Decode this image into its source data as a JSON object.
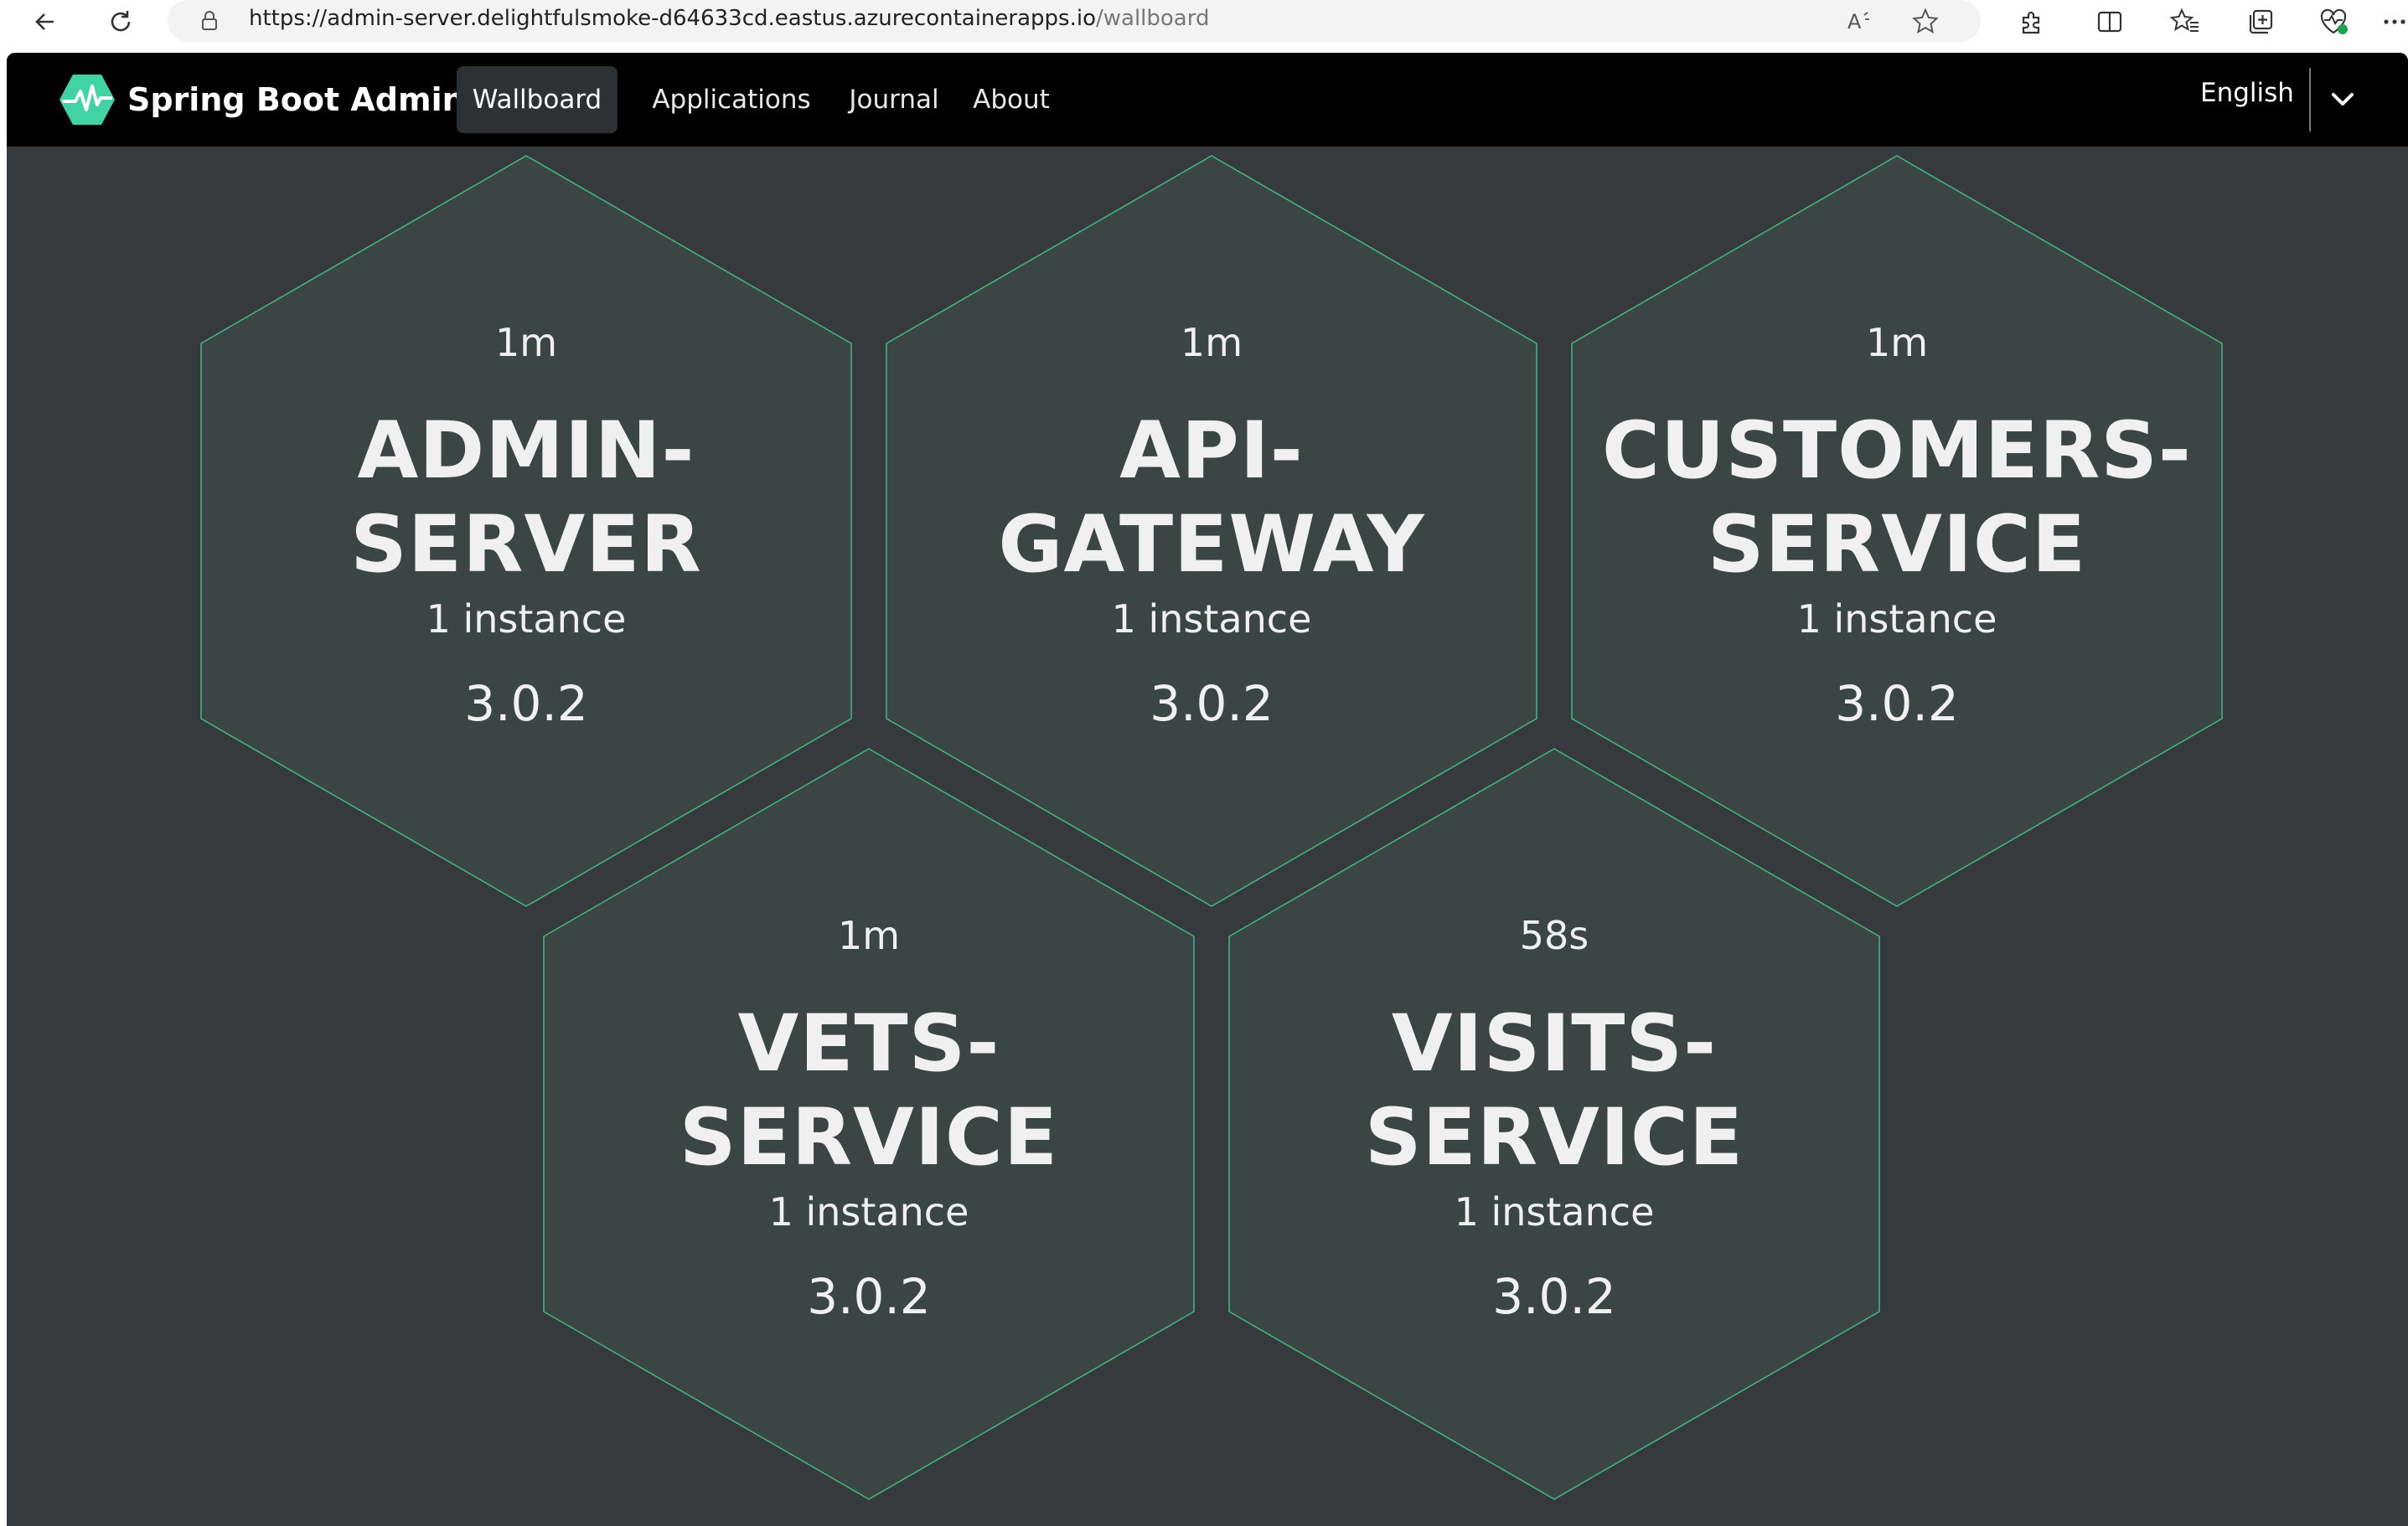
{
  "browser": {
    "url_main": "https://admin-server.delightfulsmoke-d64633cd.eastus.azurecontainerapps.io",
    "url_path": "/wallboard",
    "icons": [
      "back-arrow-icon",
      "refresh-icon",
      "lock-icon",
      "read-aloud-icon",
      "favorite-star-icon",
      "extensions-icon",
      "split-screen-icon",
      "favorites-icon",
      "collections-icon",
      "browser-essentials-icon",
      "more-icon"
    ]
  },
  "app": {
    "brand": "Spring Boot Admin",
    "nav": [
      {
        "label": "Wallboard",
        "active": true
      },
      {
        "label": "Applications",
        "active": false
      },
      {
        "label": "Journal",
        "active": false
      },
      {
        "label": "About",
        "active": false
      }
    ],
    "language": "English",
    "colors": {
      "navbar": "#000000",
      "background": "#363a3d",
      "tile_fill": "#3b4544",
      "tile_border": "#42b983",
      "brand_accent": "#42d3a5"
    }
  },
  "wallboard": {
    "applications": [
      {
        "uptime": "1m",
        "name_line1": "ADMIN-",
        "name_line2": "SERVER",
        "instances": "1 instance",
        "version": "3.0.2",
        "status": "UP"
      },
      {
        "uptime": "1m",
        "name_line1": "API-",
        "name_line2": "GATEWAY",
        "instances": "1 instance",
        "version": "3.0.2",
        "status": "UP"
      },
      {
        "uptime": "1m",
        "name_line1": "CUSTOMERS-",
        "name_line2": "SERVICE",
        "instances": "1 instance",
        "version": "3.0.2",
        "status": "UP"
      },
      {
        "uptime": "1m",
        "name_line1": "VETS-",
        "name_line2": "SERVICE",
        "instances": "1 instance",
        "version": "3.0.2",
        "status": "UP"
      },
      {
        "uptime": "58s",
        "name_line1": "VISITS-",
        "name_line2": "SERVICE",
        "instances": "1 instance",
        "version": "3.0.2",
        "status": "UP"
      }
    ]
  }
}
